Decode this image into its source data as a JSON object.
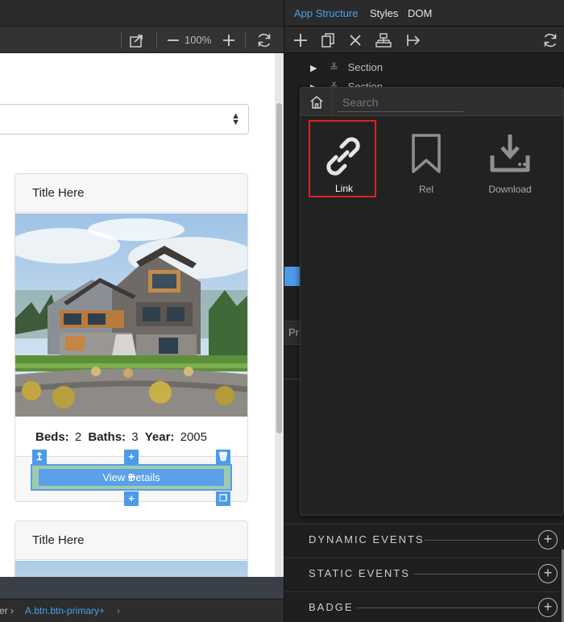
{
  "toolbar": {
    "zoom": "100%"
  },
  "canvas": {
    "cards": [
      {
        "title": "Title Here",
        "beds_label": "Beds:",
        "beds": "2",
        "baths_label": "Baths:",
        "baths": "3",
        "year_label": "Year:",
        "year": "2005",
        "button_label": "View Details"
      },
      {
        "title": "Title Here"
      }
    ]
  },
  "breadcrumb": {
    "prev": "er",
    "current": "A.btn.btn-primary+"
  },
  "right_panel": {
    "tabs": [
      "App Structure",
      "Styles",
      "DOM"
    ],
    "active_tab_color": "#4a9fea",
    "tree": [
      {
        "label": "Section"
      },
      {
        "label": "Section"
      }
    ],
    "props_tab_fragment": "Pr",
    "sections": [
      "DYNAMIC EVENTS",
      "STATIC EVENTS",
      "BADGE"
    ]
  },
  "popup": {
    "search_placeholder": "Search",
    "items": [
      {
        "label": "Link",
        "icon": "link-icon",
        "selected": true
      },
      {
        "label": "Rel",
        "icon": "bookmark-icon",
        "selected": false
      },
      {
        "label": "Download",
        "icon": "download-icon",
        "selected": false
      }
    ],
    "highlight_color": "#e02020"
  }
}
